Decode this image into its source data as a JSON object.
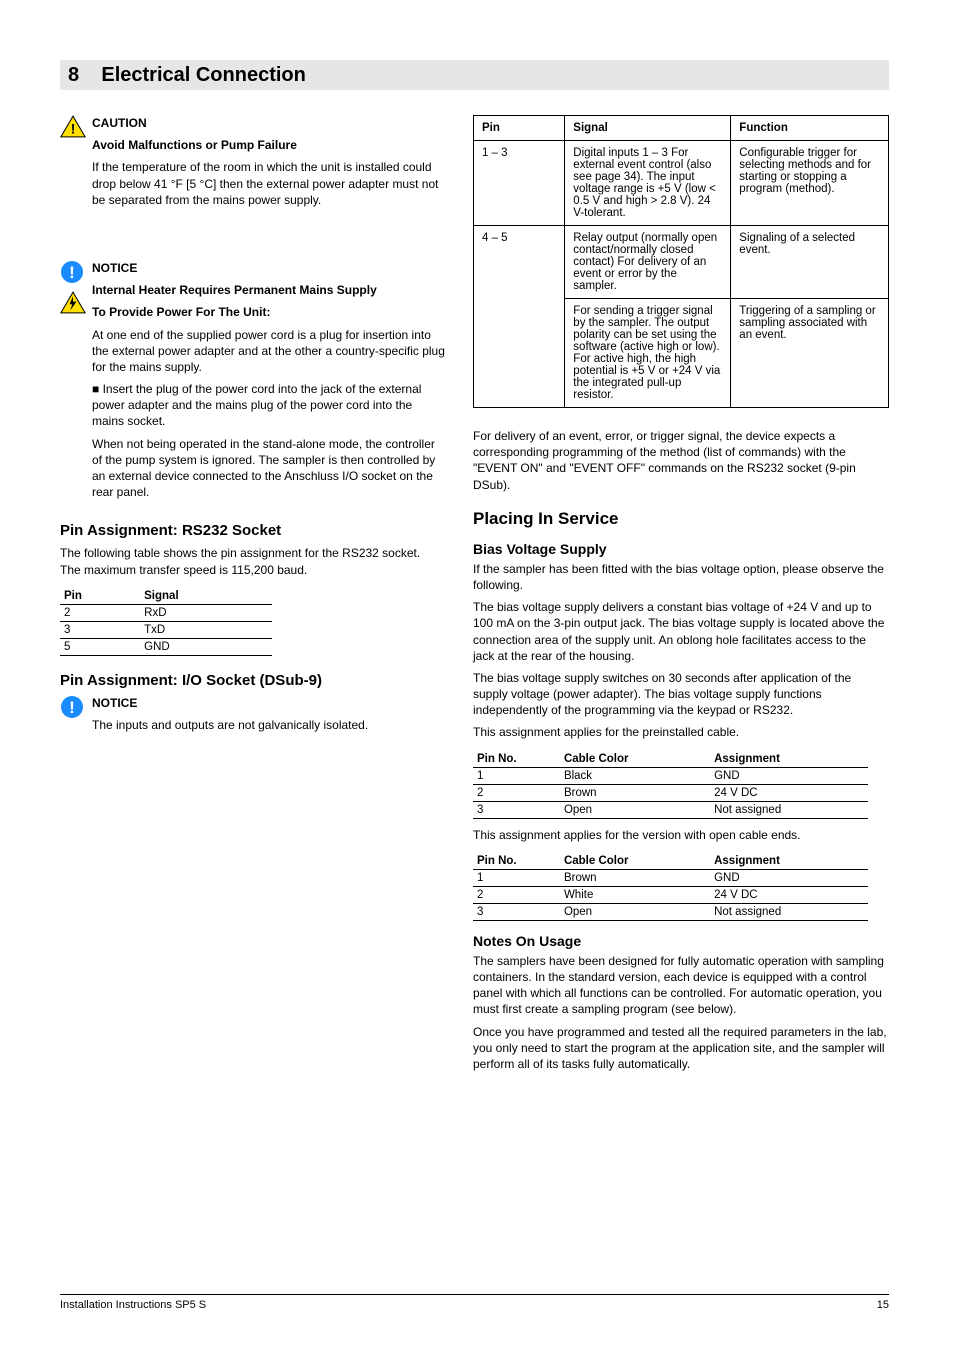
{
  "section_number": "8",
  "section_title": "Electrical Connection",
  "left": {
    "caution_label": "CAUTION",
    "caution_p1": "Avoid Malfunctions or Pump Failure",
    "caution_p2": "If the temperature of the room in which the unit is installed could drop below 41 °F [5 °C] then the external power adapter must not be separated from the mains power supply.",
    "notice_label": "NOTICE",
    "notice_p1": "Internal Heater Requires Permanent Mains Supply",
    "notice_p2": "To Provide Power For The Unit:",
    "notice_p3": "At one end of the supplied power cord is a plug for insertion into the external power adapter and at the other a country-specific plug for the mains supply.",
    "notice_p4": "■    Insert the plug of the power cord into the jack of the external power adapter and the mains plug of the power cord into the mains socket.",
    "notice_p5": "When not being operated in the stand-alone mode, the controller of the pump system is ignored. The sampler is then controlled by an external device connected to the Anschluss I/O socket on the rear panel.",
    "rs232_head": "Pin Assignment: RS232 Socket",
    "rs232_p1": "The following table shows the pin assignment for the RS232 socket. ",
    "rs232_p2": "The maximum transfer speed is 115,200 baud.",
    "pin_head": "Pin",
    "signal_head": "Signal",
    "rs232_rows": [
      {
        "pin": "2",
        "signal": "RxD"
      },
      {
        "pin": "3",
        "signal": "TxD"
      },
      {
        "pin": "5",
        "signal": "GND"
      }
    ],
    "io_head": "Pin Assignment: I/O Socket (DSub-9)",
    "io_notice_label": "NOTICE",
    "io_notice_p1": "The inputs and outputs are not galvanically isolated."
  },
  "right": {
    "table1": {
      "h1": "Pin",
      "h2": "Signal",
      "h3": "Function",
      "rows": [
        {
          "pin": "1 – 3",
          "signal": "Digital inputs 1 – 3 For external event control (also see page 34). The input voltage range is +5 V (low < 0.5 V and high > 2.8 V). 24 V-tolerant.",
          "func": "Configurable trigger for selecting methods and for starting or stopping a program (method)."
        },
        {
          "pin": "4 – 5",
          "signal": "Relay output (normally open contact/normally closed contact) For delivery of an event or error by the sampler.",
          "func": "Signaling of a selected event."
        },
        {
          "pin": "",
          "signal": "For sending a trigger signal by the sampler. The output polarity can be set using the software (active high or low). For active high, the high potential is +5 V or +24 V via the integrated pull-up resistor.",
          "func": "Triggering of a sampling or sampling associated with an event."
        }
      ]
    },
    "p_after": "For delivery of an event, error, or trigger signal, the device expects a corresponding programming of the method (list of commands) with the \"EVENT ON\" and \"EVENT OFF\" commands on the RS232 socket (9-pin DSub).",
    "placing_head": "Placing In Service",
    "bias_head": "Bias Voltage Supply",
    "bias_p1": "If the sampler has been fitted with the bias voltage option, please observe the following.",
    "bias_p2": "The bias voltage supply delivers a constant bias voltage of +24 V and up to 100 mA on the 3-pin output jack. The bias voltage supply is located above the connection area of the supply unit. An oblong hole facilitates access to the jack at the rear of the housing.",
    "bias_p3": "The bias voltage supply switches on 30 seconds after application of the supply voltage (power adapter). The bias voltage supply functions independently of the programming via the keypad or RS232.",
    "bias_p4": "This assignment applies for the preinstalled cable.",
    "table2a": {
      "h1": "Pin No.",
      "h2": "Cable Color",
      "h3": "Assignment",
      "rows": [
        {
          "a": "1",
          "b": "Black",
          "c": "GND"
        },
        {
          "a": "2",
          "b": "Brown",
          "c": "24 V DC"
        },
        {
          "a": "3",
          "b": "Open",
          "c": "Not assigned"
        }
      ]
    },
    "bias_p5": "This assignment applies for the version with open cable ends.",
    "table2b": {
      "h1": "Pin No.",
      "h2": "Cable Color",
      "h3": "Assignment",
      "rows": [
        {
          "a": "1",
          "b": "Brown",
          "c": "GND"
        },
        {
          "a": "2",
          "b": "White",
          "c": "24 V DC"
        },
        {
          "a": "3",
          "b": "Open",
          "c": "Not assigned"
        }
      ]
    },
    "usage_head": "Notes On Usage",
    "usage_p1": "The samplers have been designed for fully automatic operation with sampling containers. In the standard version, each device is equipped with a control panel with which all functions can be controlled. For automatic operation, you must first create a sampling program (see below).",
    "usage_p2": "Once you have programmed and tested all the required parameters in the lab, you only need to start the program at the application site, and the sampler will perform all of its tasks fully automatically."
  },
  "footer": {
    "left": "Installation Instructions SP5 S",
    "right": "15"
  }
}
